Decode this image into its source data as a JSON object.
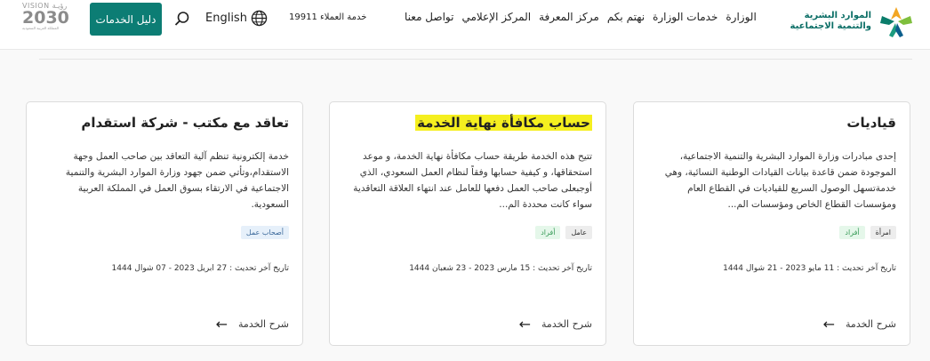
{
  "header": {
    "logo_line1": "الموارد البشرية",
    "logo_line2": "والتنمية الاجتماعية",
    "nav": [
      "الوزارة",
      "خدمات الوزارة",
      "نهتم بكم",
      "مركز المعرفة",
      "المركز الإعلامي",
      "تواصل معنا"
    ],
    "customer_service": "خدمة العملاء 19911",
    "language": "English",
    "guide_button": "دليل الخدمات",
    "vision_top": "VISION رؤيـة",
    "vision_year": "2030",
    "vision_sub": "المملكة العربية السعودية"
  },
  "cards": [
    {
      "title": "قياديات",
      "desc": "إحدى مبادرات وزارة الموارد البشرية والتنمية الاجتماعية، الموجودة ضمن قاعدة بيانات القيادات الوطنية النسائية، وهي خدمةتسهل الوصول السريع للقياديات في القطاع العام ومؤسسات القطاع الخاص ومؤسسات الم...",
      "tags": [
        "امرأة",
        "أفراد"
      ],
      "updated": "تاريخ آخر تحديث : 11 مايو 2023 - 21 شوال 1444",
      "more": "شرح الخدمة"
    },
    {
      "title": "حساب مكافأة نهاية الخدمة",
      "desc": "تتيح هذه الخدمة طريقة حساب مكافأة نهاية الخدمة، و موعد استحقاقها، و كيفية حسابها وفقاً لنظام العمل السعودي، الذي أوجبعلى صاحب العمل دفعها للعامل عند انتهاء العلاقة التعاقدية سواء كانت محددة الم...",
      "tags": [
        "عامل",
        "أفراد"
      ],
      "updated": "تاريخ آخر تحديث : 15 مارس 2023 - 23 شعبان 1444",
      "more": "شرح الخدمة"
    },
    {
      "title": "تعاقد مع مكتب - شركة استقدام",
      "desc": "خدمة إلكترونية تنظم آلية التعاقد بين صاحب العمل وجهة الاستقدام،وتأتي ضمن جهود وزارة الموارد البشرية والتنمية الاجتماعية في الارتقاء بسوق العمل في المملكة العربية السعودية.",
      "tags": [
        "أصحاب عمل"
      ],
      "updated": "تاريخ آخر تحديث : 27 ابريل 2023 - 07 شوال 1444",
      "more": "شرح الخدمة"
    }
  ]
}
